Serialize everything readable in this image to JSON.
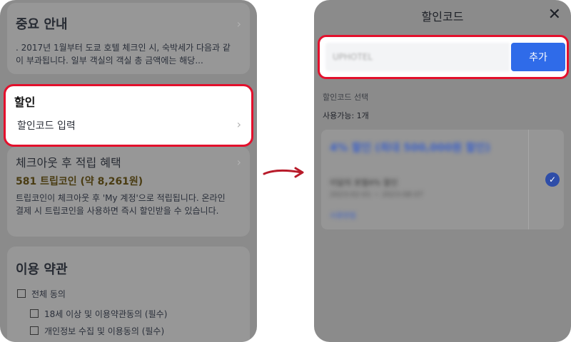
{
  "left": {
    "notice": {
      "title": "중요 안내",
      "body": ". 2017년 1월부터 도쿄 호텔 체크인 시, 숙박세가 다음과 같이 부과됩니다. 일부 객실의 객실 총 금액에는 해당..."
    },
    "discount": {
      "title": "할인",
      "link": "할인코드 입력"
    },
    "reward": {
      "title": "체크아웃 후 적립 혜택",
      "points": "581 트립코인 (약 8,261원)",
      "body": "트립코인이 체크아웃 후 'My 계정'으로 적립됩니다. 온라인 결제 시 트립코인을 사용하면 즉시 할인받을 수 있습니다."
    },
    "terms": {
      "title": "이용 약관",
      "items": [
        "전체 동의",
        "18세 이상 및 이용약관동의 (필수)",
        "개인정보 수집 및 이용동의 (필수)"
      ]
    }
  },
  "right": {
    "title": "할인코드",
    "input_value": "UPHOTEL",
    "add_label": "추가",
    "select_label": "할인코드 선택",
    "available": "사용가능: 1개",
    "coupon": {
      "title": "4% 할인 (최대 500,000원 할인)",
      "desc": "이달의 호텔4% 할인",
      "expiry": "2023-02-01 ~ 2023-08-07",
      "link": "사용방법"
    }
  },
  "colors": {
    "highlight": "#e3102c",
    "accent": "#2f6be9",
    "arrow": "#b81b2a"
  }
}
